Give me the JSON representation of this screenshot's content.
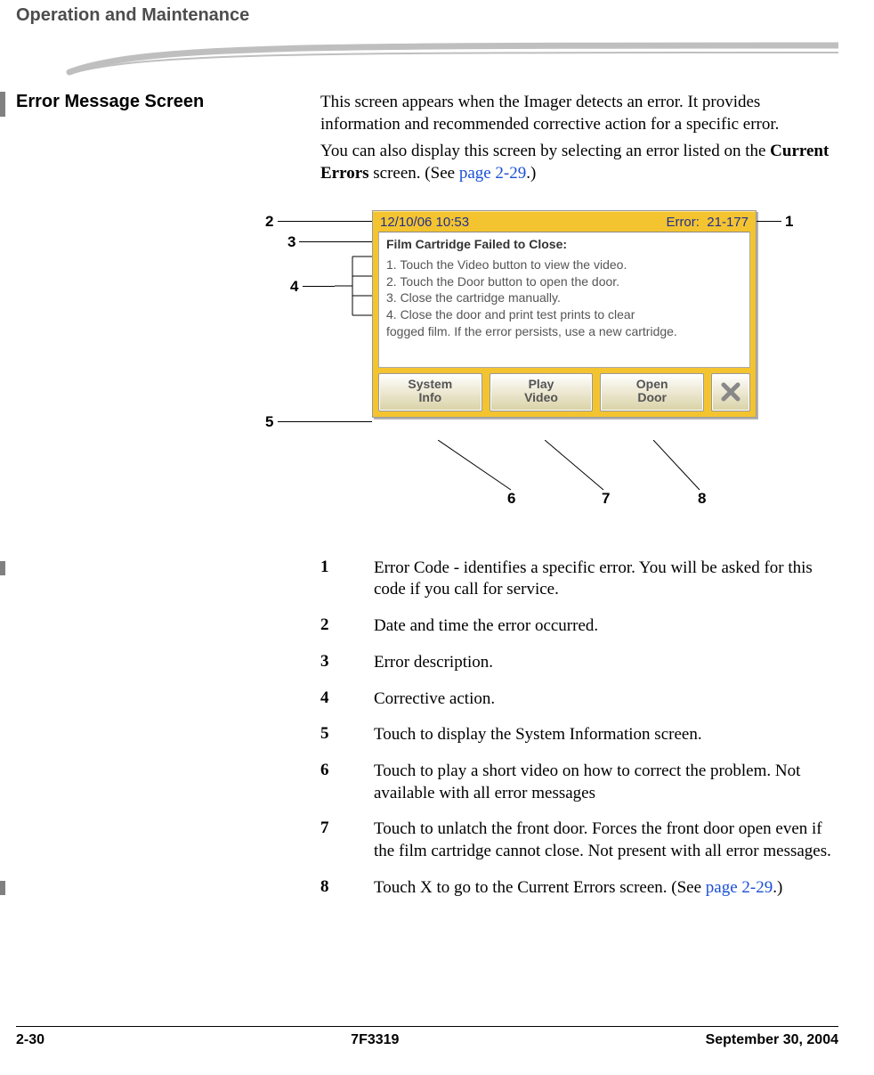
{
  "header": {
    "running_head": "Operation and Maintenance"
  },
  "section": {
    "title": "Error Message Screen",
    "para1": "This screen appears when the Imager detects an error. It provides information and recommended corrective action for a specific error.",
    "para2_pre": "You can also display this screen by selecting an error listed on the ",
    "para2_bold": "Current Errors",
    "para2_mid": " screen. (See ",
    "para2_link": "page 2-29",
    "para2_post": ".)"
  },
  "dialog": {
    "datetime": "12/10/06 10:53",
    "error_label": "Error:",
    "error_code": "21-177",
    "body_title": "Film Cartridge Failed to Close:",
    "steps": [
      "1. Touch the Video button to view the video.",
      "2. Touch the Door button to open the door.",
      "3. Close the cartridge manually.",
      "4. Close the door and print test prints to clear"
    ],
    "steps_tail": "fogged film. If the error persists, use a new cartridge.",
    "buttons": {
      "system_info_l1": "System",
      "system_info_l2": "Info",
      "play_video_l1": "Play",
      "play_video_l2": "Video",
      "open_door_l1": "Open",
      "open_door_l2": "Door"
    }
  },
  "callouts": {
    "c1": "1",
    "c2": "2",
    "c3": "3",
    "c4": "4",
    "c5": "5",
    "c6": "6",
    "c7": "7",
    "c8": "8"
  },
  "legend": [
    {
      "num": "1",
      "parts": [
        {
          "t": "Error Code - identifies a specific error. You will be asked for this code if you call for service."
        }
      ]
    },
    {
      "num": "2",
      "parts": [
        {
          "t": "Date and time the error occurred."
        }
      ]
    },
    {
      "num": "3",
      "parts": [
        {
          "t": "Error description."
        }
      ]
    },
    {
      "num": "4",
      "parts": [
        {
          "t": "Corrective action."
        }
      ]
    },
    {
      "num": "5",
      "parts": [
        {
          "t": "Touch to display the "
        },
        {
          "t": "System Information",
          "b": true
        },
        {
          "t": " screen."
        }
      ]
    },
    {
      "num": "6",
      "parts": [
        {
          "t": "Touch to play a short video on how to correct the problem. Not available with all error messages"
        }
      ]
    },
    {
      "num": "7",
      "parts": [
        {
          "t": "Touch to unlatch the front door. Forces the front door open even if the film cartridge cannot close. Not present with all error messages."
        }
      ]
    },
    {
      "num": "8",
      "parts": [
        {
          "t": "Touch "
        },
        {
          "t": "X",
          "b": true
        },
        {
          "t": " to go to the "
        },
        {
          "t": "Current Errors",
          "b": true
        },
        {
          "t": " screen. (See "
        },
        {
          "t": "page 2-29",
          "link": true
        },
        {
          "t": ".)"
        }
      ]
    }
  ],
  "footer": {
    "left": "2-30",
    "center": "7F3319",
    "right": "September 30, 2004"
  }
}
